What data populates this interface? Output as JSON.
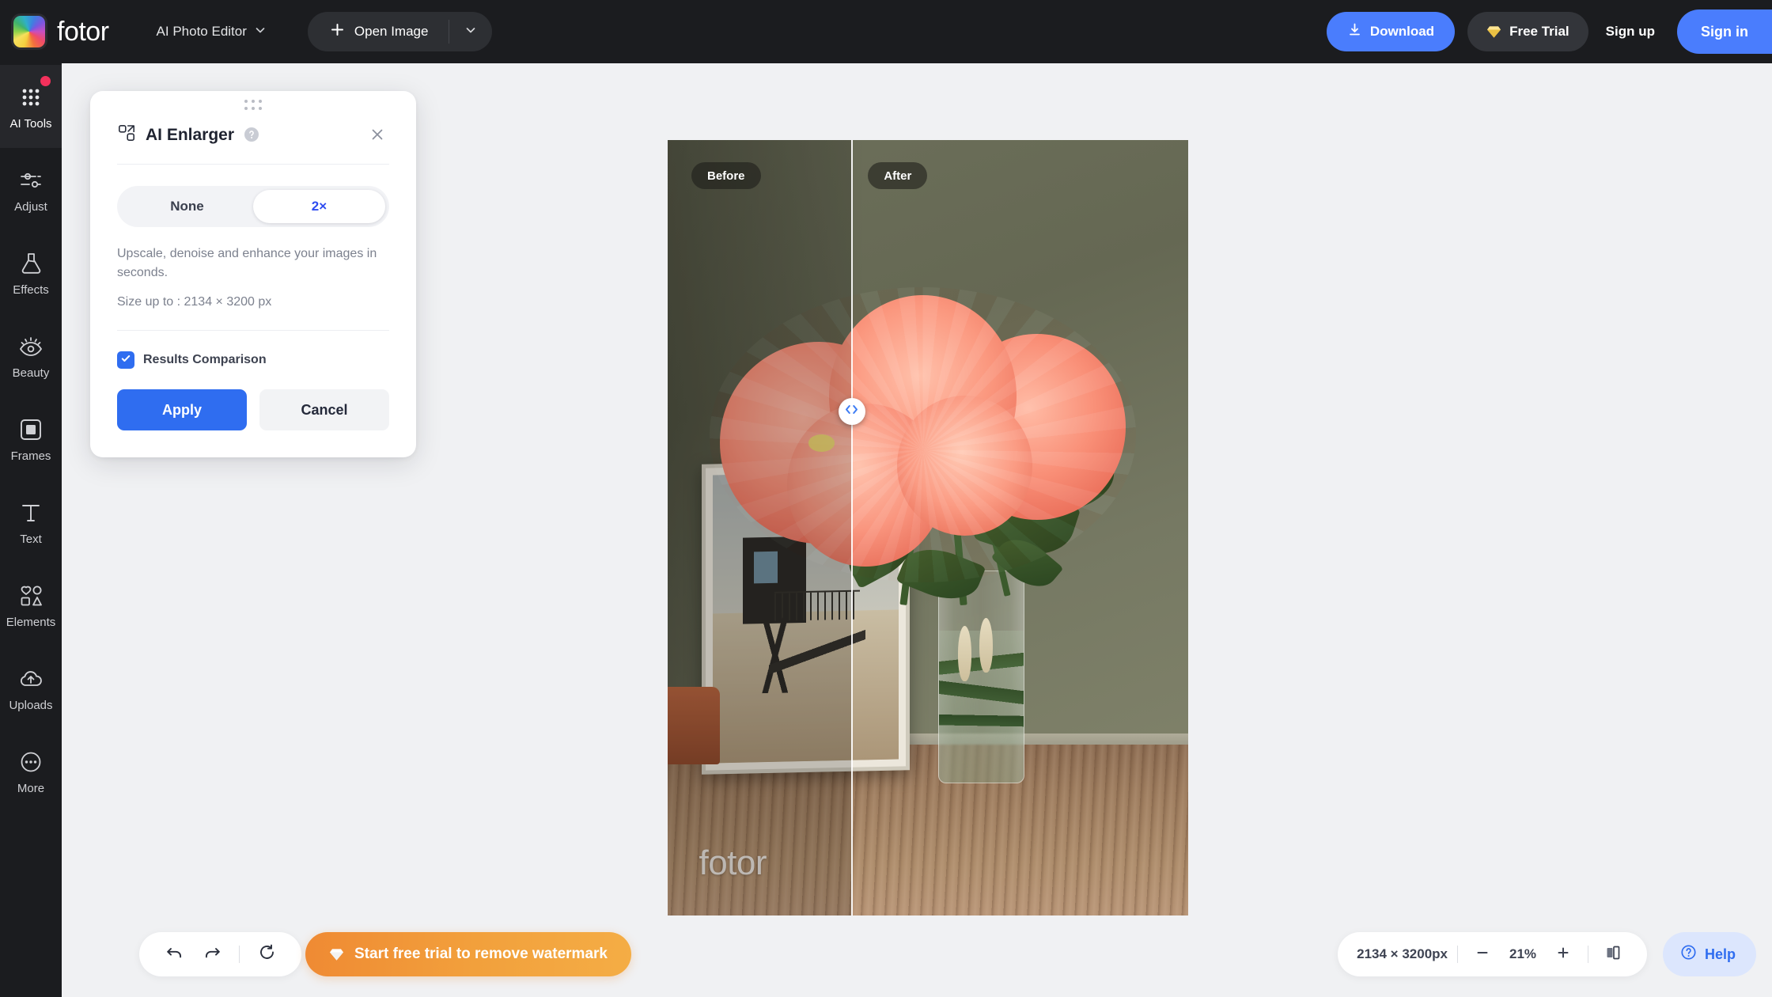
{
  "header": {
    "brand": "fotor",
    "brand_logo_icon": "fotor-color-wheel-logo",
    "app_switcher_label": "AI Photo Editor",
    "app_switcher_icon": "chevron-down-icon",
    "open_image_label": "Open Image",
    "open_image_icon": "plus-icon",
    "open_image_dropdown_icon": "chevron-down-icon",
    "download_label": "Download",
    "download_icon": "download-icon",
    "free_trial_label": "Free Trial",
    "free_trial_icon": "diamond-icon",
    "sign_up_label": "Sign up",
    "sign_in_label": "Sign in",
    "accent_blue": "#4a7dfd",
    "background": "#1b1c1f"
  },
  "sidebar": {
    "items": [
      {
        "label": "AI Tools",
        "icon": "grid-dots-icon",
        "active": true,
        "badge": true
      },
      {
        "label": "Adjust",
        "icon": "sliders-icon",
        "active": false,
        "badge": false
      },
      {
        "label": "Effects",
        "icon": "flask-icon",
        "active": false,
        "badge": false
      },
      {
        "label": "Beauty",
        "icon": "eye-icon",
        "active": false,
        "badge": false
      },
      {
        "label": "Frames",
        "icon": "frame-square-icon",
        "active": false,
        "badge": false
      },
      {
        "label": "Text",
        "icon": "text-t-icon",
        "active": false,
        "badge": false
      },
      {
        "label": "Elements",
        "icon": "shapes-icon",
        "active": false,
        "badge": false
      },
      {
        "label": "Uploads",
        "icon": "cloud-upload-icon",
        "active": false,
        "badge": false
      },
      {
        "label": "More",
        "icon": "ellipsis-circle-icon",
        "active": false,
        "badge": false
      }
    ]
  },
  "panel": {
    "title": "AI Enlarger",
    "title_icon": "ai-enlarger-icon",
    "help_icon": "question-circle-icon",
    "close_icon": "close-icon",
    "grip_icon": "drag-handle-dots-icon",
    "scale_options": [
      {
        "label": "None",
        "selected": false
      },
      {
        "label": "2×",
        "selected": true
      }
    ],
    "description": "Upscale, denoise and enhance your images in seconds.",
    "size_note": "Size up to : 2134 × 3200 px",
    "results_comparison_label": "Results Comparison",
    "results_comparison_checked": true,
    "checkbox_icon": "checkmark-icon",
    "apply_label": "Apply",
    "cancel_label": "Cancel",
    "accent_blue": "#2f6df0"
  },
  "canvas": {
    "before_tag": "Before",
    "after_tag": "After",
    "watermark_text": "fotor",
    "split_handle_icon": "left-right-arrows-icon",
    "split_position_percent": 35
  },
  "bottom_bar": {
    "undo_icon": "undo-arrow-icon",
    "redo_icon": "redo-arrow-icon",
    "reset_icon": "reset-circular-arrow-icon",
    "cta_label": "Start free trial to remove watermark",
    "cta_icon": "diamond-icon",
    "cta_color": "#f09a38",
    "dimensions": "2134 × 3200px",
    "zoom_out_icon": "minus-icon",
    "zoom_level": "21%",
    "zoom_in_icon": "plus-icon",
    "compare_view_icon": "split-compare-icon",
    "help_label": "Help",
    "help_icon": "question-circle-icon",
    "help_color": "#2f6df0"
  }
}
